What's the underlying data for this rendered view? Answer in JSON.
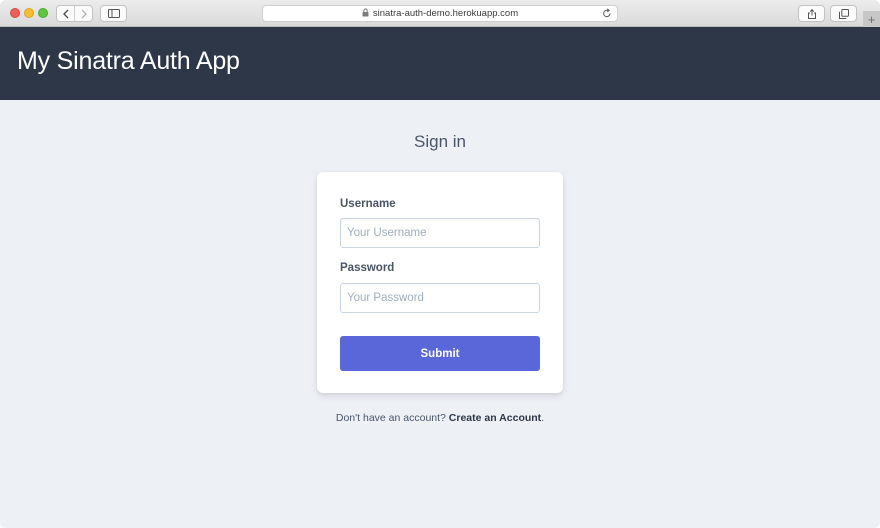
{
  "browser": {
    "url": "sinatra-auth-demo.herokuapp.com",
    "new_tab_symbol": "+",
    "icons": {
      "lock": "lock-icon",
      "reload": "reload-icon",
      "back": "chevron-left-icon",
      "forward": "chevron-right-icon",
      "sidebar": "sidebar-icon",
      "share": "share-icon",
      "tabs": "tabs-overview-icon"
    }
  },
  "header": {
    "title": "My Sinatra Auth App",
    "background_color": "#2d3748"
  },
  "page": {
    "heading": "Sign in",
    "background_color": "#edf1f6"
  },
  "form": {
    "username_label": "Username",
    "username_placeholder": "Your Username",
    "username_value": "",
    "password_label": "Password",
    "password_placeholder": "Your Password",
    "password_value": "",
    "submit_label": "Submit",
    "submit_color": "#5a67d8"
  },
  "footer": {
    "prompt": "Don't have an account?",
    "link_text": "Create an Account",
    "trailing": "."
  }
}
